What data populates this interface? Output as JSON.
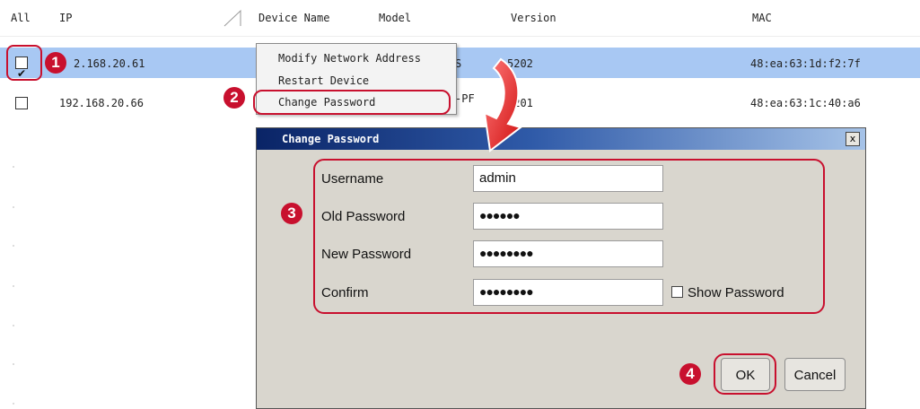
{
  "header": {
    "all": "All",
    "ip": "IP",
    "device_name": "Device Name",
    "model": "Model",
    "version": "Version",
    "mac": "MAC"
  },
  "rows": [
    {
      "ip": "2.168.20.61",
      "model_partial": "S",
      "version": "5202",
      "mac": "48:ea:63:1d:f2:7f",
      "checked": true
    },
    {
      "ip": "192.168.20.66",
      "model_partial": "-PF",
      "version": "1201",
      "mac": "48:ea:63:1c:40:a6",
      "checked": false
    }
  ],
  "context_menu": {
    "items": [
      "Modify Network Address",
      "Restart Device",
      "Change Password"
    ]
  },
  "dialog": {
    "title": "Change Password",
    "close": "x",
    "username_label": "Username",
    "username_value": "admin",
    "old_password_label": "Old Password",
    "old_password_value": "●●●●●●",
    "new_password_label": "New Password",
    "new_password_value": "●●●●●●●●",
    "confirm_label": "Confirm",
    "confirm_value": "●●●●●●●●",
    "show_password_label": "Show Password",
    "ok_label": "OK",
    "cancel_label": "Cancel"
  },
  "annotations": [
    "1",
    "2",
    "3",
    "4"
  ],
  "colors": {
    "annotation_red": "#c8102e",
    "selected_row": "#a8c8f3",
    "title_bar": "#0a2466"
  }
}
